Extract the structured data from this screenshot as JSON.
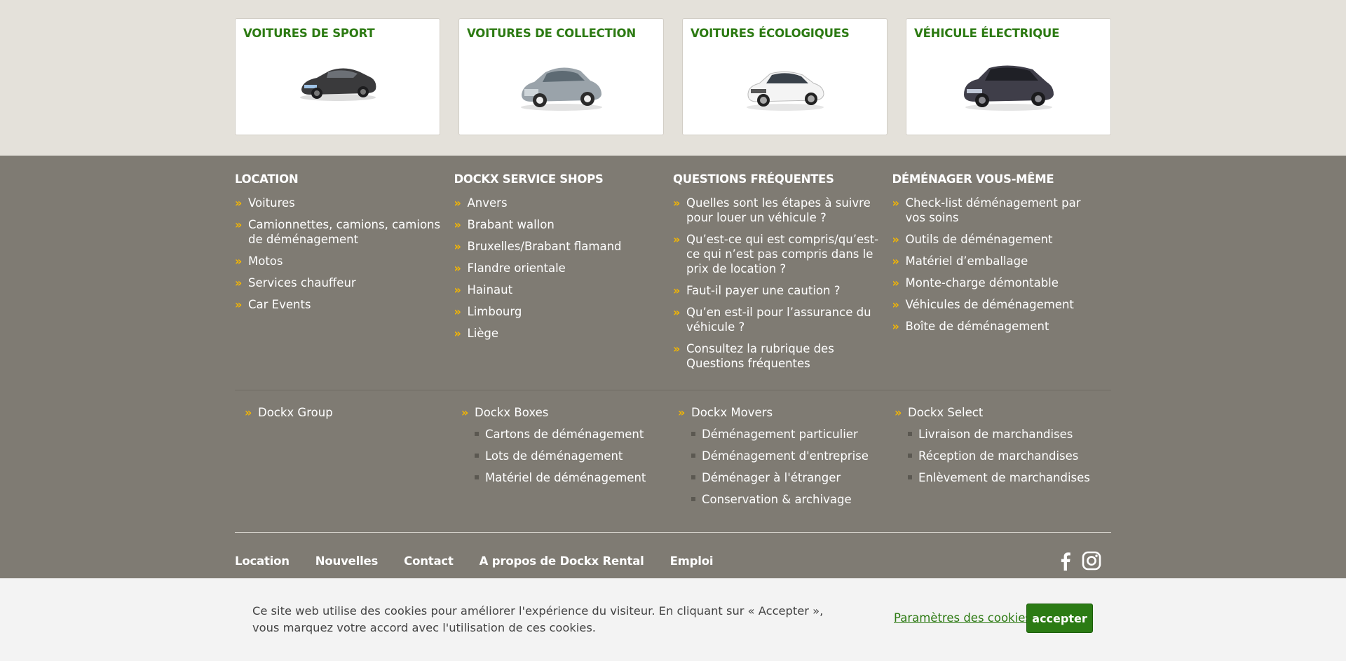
{
  "cards": [
    {
      "title": "VOITURES DE SPORT",
      "icon": "sports-car-icon"
    },
    {
      "title": "VOITURES DE COLLECTION",
      "icon": "classic-car-icon"
    },
    {
      "title": "VOITURES ÉCOLOGIQUES",
      "icon": "eco-car-icon"
    },
    {
      "title": "VÉHICULE ÉLECTRIQUE",
      "icon": "electric-car-icon"
    }
  ],
  "columns": [
    {
      "heading": "LOCATION",
      "items": [
        "Voitures",
        "Camionnettes, camions, camions de déménagement",
        "Motos",
        "Services chauffeur",
        "Car Events"
      ]
    },
    {
      "heading": "DOCKX SERVICE SHOPS",
      "items": [
        "Anvers",
        "Brabant wallon",
        "Bruxelles/Brabant flamand",
        "Flandre orientale",
        "Hainaut",
        "Limbourg",
        "Liège"
      ]
    },
    {
      "heading": "QUESTIONS FRÉQUENTES",
      "items": [
        "Quelles sont les étapes à suivre pour louer un véhicule ?",
        "Qu’est-ce qui est compris/qu’est-ce qui n’est pas compris dans le prix de location ?",
        "Faut-il payer une caution ?",
        "Qu’en est-il pour l’assurance du véhicule ?",
        "Consultez la rubrique des Questions fréquentes"
      ]
    },
    {
      "heading": "DÉMÉNAGER VOUS-MÊME",
      "items": [
        "Check-list déménagement par vos soins",
        "Outils de déménagement",
        "Matériel d’emballage",
        "Monte-charge démontable",
        "Véhicules de déménagement",
        "Boîte de déménagement"
      ]
    }
  ],
  "groups": [
    {
      "title": "Dockx Group",
      "items": []
    },
    {
      "title": "Dockx Boxes",
      "items": [
        "Cartons de déménagement",
        "Lots de déménagement",
        "Matériel de déménagement"
      ]
    },
    {
      "title": "Dockx Movers",
      "items": [
        "Déménagement particulier",
        "Déménagement d'entreprise",
        "Déménager à l'étranger",
        "Conservation & archivage"
      ]
    },
    {
      "title": "Dockx Select",
      "items": [
        "Livraison de marchandises",
        "Réception de marchandises",
        "Enlèvement de marchandises"
      ]
    }
  ],
  "bottom_nav": [
    "Location",
    "Nouvelles",
    "Contact",
    "A propos de Dockx Rental",
    "Emploi"
  ],
  "social": [
    "facebook-icon",
    "instagram-icon"
  ],
  "cookie": {
    "text": "Ce site web utilise des cookies pour améliorer l'expérience du visiteur. En cliquant sur « Accepter », vous marquez votre accord avec l'utilisation de ces cookies.",
    "settings_label": "Paramètres des cookies",
    "accept_label": "accepter"
  },
  "colors": {
    "accent_green": "#2c7a12",
    "chevron": "#f5b700",
    "footer_bg": "#7f7b73"
  }
}
